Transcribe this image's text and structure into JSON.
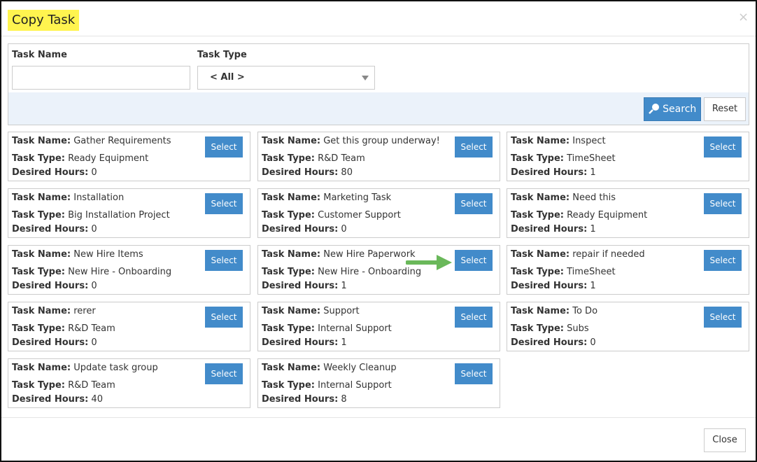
{
  "dialog": {
    "title": "Copy Task",
    "close_icon": "×"
  },
  "filters": {
    "task_name_label": "Task Name",
    "task_name_value": "",
    "task_type_label": "Task Type",
    "task_type_value": "< All >",
    "search_label": "Search",
    "reset_label": "Reset"
  },
  "labels": {
    "name": "Task Name:",
    "type": "Task Type:",
    "hours": "Desired Hours:",
    "select": "Select"
  },
  "tasks": [
    {
      "name": "Gather Requirements",
      "type": "Ready Equipment",
      "hours": "0"
    },
    {
      "name": "Get this group underway!",
      "type": "R&D Team",
      "hours": "80"
    },
    {
      "name": "Inspect",
      "type": "TimeSheet",
      "hours": "1"
    },
    {
      "name": "Installation",
      "type": "Big Installation Project",
      "hours": "0"
    },
    {
      "name": "Marketing Task",
      "type": "Customer Support",
      "hours": "0"
    },
    {
      "name": "Need this",
      "type": "Ready Equipment",
      "hours": "1"
    },
    {
      "name": "New Hire Items",
      "type": "New Hire - Onboarding",
      "hours": "0"
    },
    {
      "name": "New Hire Paperwork",
      "type": "New Hire - Onboarding",
      "hours": "1"
    },
    {
      "name": "repair if needed",
      "type": "TimeSheet",
      "hours": "1"
    },
    {
      "name": "rerer",
      "type": "R&D Team",
      "hours": "0"
    },
    {
      "name": "Support",
      "type": "Internal Support",
      "hours": "1"
    },
    {
      "name": "To Do",
      "type": "Subs",
      "hours": "0"
    },
    {
      "name": "Update task group",
      "type": "R&D Team",
      "hours": "40"
    },
    {
      "name": "Weekly Cleanup",
      "type": "Internal Support",
      "hours": "8"
    }
  ],
  "footer": {
    "close_label": "Close"
  },
  "colors": {
    "primary": "#428bca",
    "highlight": "#fff44f",
    "arrow": "#6ab85a"
  }
}
